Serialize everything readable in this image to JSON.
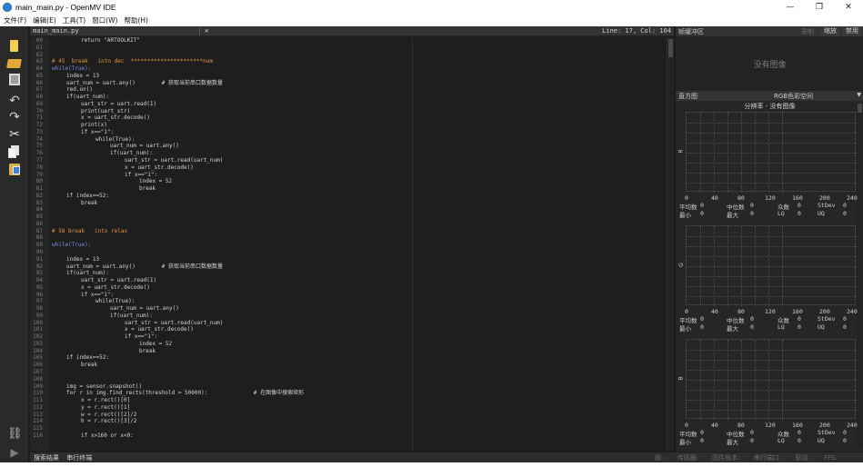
{
  "window": {
    "title": "main_main.py - OpenMV IDE",
    "minimize_glyph": "—",
    "maximize_glyph": "❐",
    "close_glyph": "✕"
  },
  "menu": [
    "文件(F)",
    "编辑(E)",
    "工具(T)",
    "窗口(W)",
    "帮助(H)"
  ],
  "toolbar_icons": [
    "new-file-icon",
    "open-folder-icon",
    "save-icon",
    "undo-icon",
    "redo-icon",
    "cut-icon",
    "copy-icon",
    "paste-icon",
    "connect-icon",
    "run-icon"
  ],
  "editor": {
    "filename": "main_main.py",
    "close_glyph": "✕",
    "position": "Line: 17, Col: 104",
    "lines": [
      {
        "n": "60",
        "indent": 2,
        "text": "return \"ARTOOLKIT\"",
        "cls": ""
      },
      {
        "n": "61",
        "indent": 0,
        "text": "",
        "cls": ""
      },
      {
        "n": "62",
        "indent": 0,
        "text": "",
        "cls": ""
      },
      {
        "n": "63",
        "indent": 0,
        "text": "# 45  break   into dec  **********************num",
        "cls": "cmt"
      },
      {
        "n": "64",
        "indent": 0,
        "text": "while(True):",
        "cls": "kw"
      },
      {
        "n": "65",
        "indent": 1,
        "text": "index = 13",
        "cls": ""
      },
      {
        "n": "66",
        "indent": 1,
        "text": "uart_num = uart.any()        # 获取当前串口数据数量",
        "cls": ""
      },
      {
        "n": "67",
        "indent": 1,
        "text": "red.on()",
        "cls": ""
      },
      {
        "n": "68",
        "indent": 1,
        "text": "if(uart_num):",
        "cls": ""
      },
      {
        "n": "69",
        "indent": 2,
        "text": "uart_str = uart.read(1)",
        "cls": ""
      },
      {
        "n": "70",
        "indent": 2,
        "text": "print(uart_str)",
        "cls": ""
      },
      {
        "n": "71",
        "indent": 2,
        "text": "x = uart_str.decode()",
        "cls": ""
      },
      {
        "n": "72",
        "indent": 2,
        "text": "print(x)",
        "cls": ""
      },
      {
        "n": "73",
        "indent": 2,
        "text": "if x==\"1\":",
        "cls": ""
      },
      {
        "n": "74",
        "indent": 3,
        "text": "while(True):",
        "cls": ""
      },
      {
        "n": "75",
        "indent": 4,
        "text": "uart_num = uart.any()",
        "cls": ""
      },
      {
        "n": "76",
        "indent": 4,
        "text": "if(uart_num):",
        "cls": ""
      },
      {
        "n": "77",
        "indent": 5,
        "text": "uart_str = uart.read(uart_num)",
        "cls": ""
      },
      {
        "n": "78",
        "indent": 5,
        "text": "x = uart_str.decode()",
        "cls": ""
      },
      {
        "n": "79",
        "indent": 5,
        "text": "if x==\"1\":",
        "cls": ""
      },
      {
        "n": "80",
        "indent": 6,
        "text": "index = 52",
        "cls": ""
      },
      {
        "n": "81",
        "indent": 6,
        "text": "break",
        "cls": ""
      },
      {
        "n": "82",
        "indent": 1,
        "text": "if index==52:",
        "cls": ""
      },
      {
        "n": "83",
        "indent": 2,
        "text": "break",
        "cls": ""
      },
      {
        "n": "84",
        "indent": 0,
        "text": "",
        "cls": ""
      },
      {
        "n": "85",
        "indent": 0,
        "text": "",
        "cls": ""
      },
      {
        "n": "86",
        "indent": 0,
        "text": "",
        "cls": ""
      },
      {
        "n": "87",
        "indent": 0,
        "text": "# 58 break   into relax",
        "cls": "cmt"
      },
      {
        "n": "88",
        "indent": 0,
        "text": "",
        "cls": ""
      },
      {
        "n": "89",
        "indent": 0,
        "text": "while(True):",
        "cls": "kw"
      },
      {
        "n": "90",
        "indent": 0,
        "text": "",
        "cls": ""
      },
      {
        "n": "91",
        "indent": 1,
        "text": "index = 13",
        "cls": ""
      },
      {
        "n": "92",
        "indent": 1,
        "text": "uart_num = uart.any()        # 获取当前串口数据数量",
        "cls": ""
      },
      {
        "n": "93",
        "indent": 1,
        "text": "if(uart_num):",
        "cls": ""
      },
      {
        "n": "94",
        "indent": 2,
        "text": "uart_str = uart.read(1)",
        "cls": ""
      },
      {
        "n": "95",
        "indent": 2,
        "text": "x = uart_str.decode()",
        "cls": ""
      },
      {
        "n": "96",
        "indent": 2,
        "text": "if x==\"1\":",
        "cls": ""
      },
      {
        "n": "97",
        "indent": 3,
        "text": "while(True):",
        "cls": ""
      },
      {
        "n": "98",
        "indent": 4,
        "text": "uart_num = uart.any()",
        "cls": ""
      },
      {
        "n": "99",
        "indent": 4,
        "text": "if(uart_num):",
        "cls": ""
      },
      {
        "n": "100",
        "indent": 5,
        "text": "uart_str = uart.read(uart_num)",
        "cls": ""
      },
      {
        "n": "101",
        "indent": 5,
        "text": "x = uart_str.decode()",
        "cls": ""
      },
      {
        "n": "102",
        "indent": 5,
        "text": "if x==\"1\":",
        "cls": ""
      },
      {
        "n": "103",
        "indent": 6,
        "text": "index = 52",
        "cls": ""
      },
      {
        "n": "104",
        "indent": 6,
        "text": "break",
        "cls": ""
      },
      {
        "n": "105",
        "indent": 1,
        "text": "if index==52:",
        "cls": ""
      },
      {
        "n": "106",
        "indent": 2,
        "text": "break",
        "cls": ""
      },
      {
        "n": "107",
        "indent": 0,
        "text": "",
        "cls": ""
      },
      {
        "n": "108",
        "indent": 0,
        "text": "",
        "cls": ""
      },
      {
        "n": "109",
        "indent": 1,
        "text": "img = sensor.snapshot()",
        "cls": ""
      },
      {
        "n": "110",
        "indent": 1,
        "text": "for r in img.find_rects(threshold = 50000):              # 在图像中搜索矩形",
        "cls": ""
      },
      {
        "n": "111",
        "indent": 2,
        "text": "x = r.rect()[0]",
        "cls": ""
      },
      {
        "n": "112",
        "indent": 2,
        "text": "y = r.rect()[1]",
        "cls": ""
      },
      {
        "n": "113",
        "indent": 2,
        "text": "w = r.rect()[2]/2",
        "cls": ""
      },
      {
        "n": "114",
        "indent": 2,
        "text": "h = r.rect()[3]/2",
        "cls": ""
      },
      {
        "n": "115",
        "indent": 0,
        "text": "",
        "cls": ""
      },
      {
        "n": "116",
        "indent": 2,
        "text": "if x>160 or x<0:",
        "cls": ""
      }
    ]
  },
  "statusbar": {
    "search_results": "搜索结果",
    "serial_terminal": "串行终端",
    "board": "板:",
    "sensor": "传感器:",
    "firmware": "固件版本:",
    "serial_port": "串行端口:",
    "drive": "驱动:",
    "fps": "FPS:"
  },
  "framebuffer": {
    "title": "帧缓冲区",
    "record": "录制",
    "zoom": "缩放",
    "disable": "禁用",
    "no_image": "没有图像"
  },
  "histogram": {
    "title": "直方图",
    "color_space": "RGB色彩空间",
    "resolution": "分辨率 - 没有图像",
    "channels": [
      {
        "name": "R",
        "mean_label": "平均数",
        "mean": "0",
        "median_label": "中位数",
        "median": "0",
        "mode_label": "众数",
        "mode": "0",
        "stdev_label": "StDev",
        "stdev": "0",
        "min_label": "最小",
        "min": "0",
        "max_label": "最大",
        "max": "0",
        "lq_label": "LQ",
        "lq": "0",
        "uq_label": "UQ",
        "uq": "0"
      },
      {
        "name": "G",
        "mean_label": "平均数",
        "mean": "0",
        "median_label": "中位数",
        "median": "0",
        "mode_label": "众数",
        "mode": "0",
        "stdev_label": "StDev",
        "stdev": "0",
        "min_label": "最小",
        "min": "0",
        "max_label": "最大",
        "max": "0",
        "lq_label": "LQ",
        "lq": "0",
        "uq_label": "UQ",
        "uq": "0"
      },
      {
        "name": "B",
        "mean_label": "平均数",
        "mean": "0",
        "median_label": "中位数",
        "median": "0",
        "mode_label": "众数",
        "mode": "0",
        "stdev_label": "StDev",
        "stdev": "0",
        "min_label": "最小",
        "min": "0",
        "max_label": "最大",
        "max": "0",
        "lq_label": "LQ",
        "lq": "0",
        "uq_label": "UQ",
        "uq": "0"
      }
    ],
    "x_ticks": [
      "0",
      "40",
      "80",
      "120",
      "160",
      "200",
      "240"
    ]
  }
}
